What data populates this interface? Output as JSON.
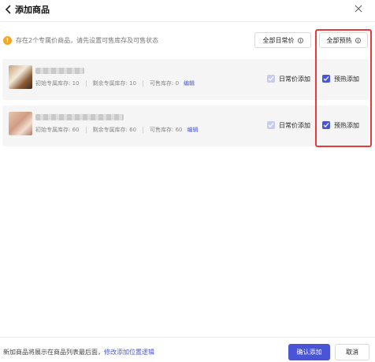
{
  "header": {
    "title": "添加商品"
  },
  "notice": {
    "text": "存在2个专属价商品，请先设置可售库存及可售状态"
  },
  "bulk_actions": {
    "daily_all_label": "全部日常价",
    "preheat_all_label": "全部预热"
  },
  "products": [
    {
      "initial_stock": "初始专属库存: 10",
      "remaining_stock": "剩余专属库存: 10",
      "available_stock": "可售库存: 0",
      "edit_label": "编辑",
      "daily_add_label": "日常价添加",
      "daily_add_checked": true,
      "daily_add_disabled": true,
      "preheat_add_label": "预热添加",
      "preheat_add_checked": true
    },
    {
      "initial_stock": "初始专属库存: 60",
      "remaining_stock": "剩余专属库存: 60",
      "available_stock": "可售库存: 60",
      "edit_label": "编辑",
      "daily_add_label": "日常价添加",
      "daily_add_checked": true,
      "daily_add_disabled": true,
      "preheat_add_label": "预热添加",
      "preheat_add_checked": true
    }
  ],
  "footer": {
    "text": "新加商品将展示在商品列表最后面，",
    "link": "修改添加位置逻辑",
    "confirm_label": "确认添加",
    "cancel_label": "取消"
  },
  "colors": {
    "accent": "#4a55d6",
    "warning": "#f5a623",
    "highlight": "#e83a3a"
  }
}
